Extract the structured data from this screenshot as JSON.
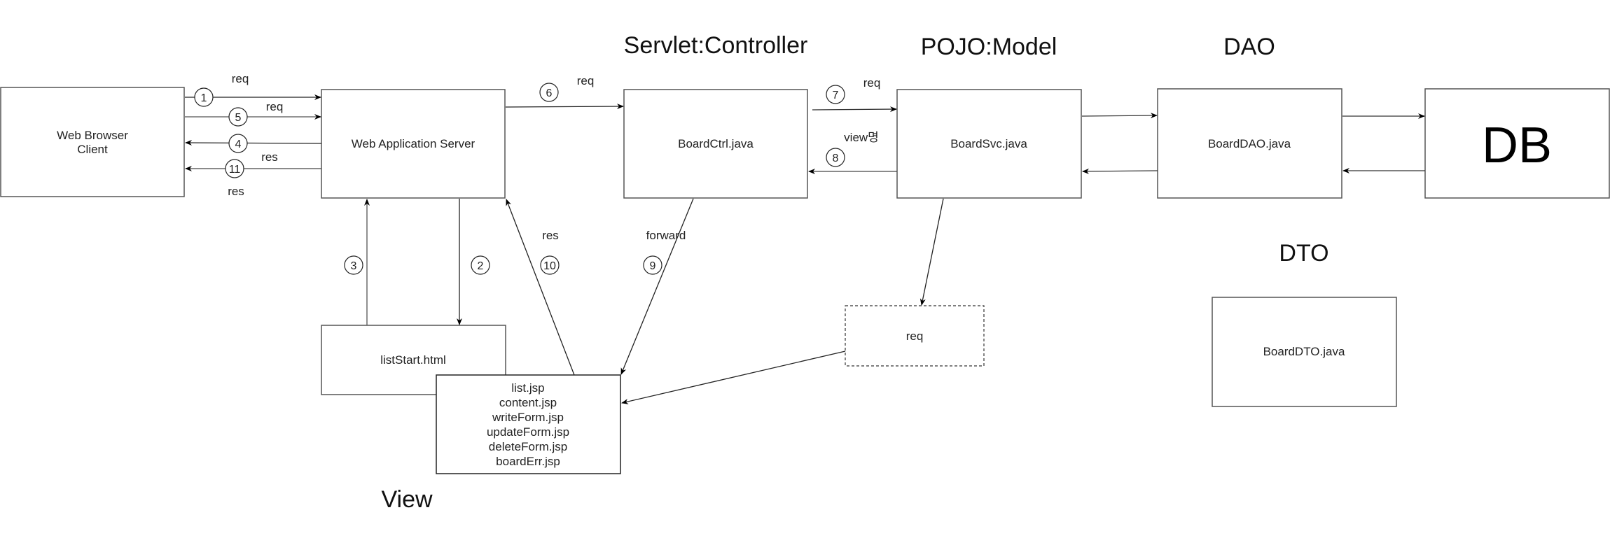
{
  "section_titles": {
    "controller": "Servlet:Controller",
    "model": "POJO:Model",
    "dao": "DAO",
    "dto": "DTO",
    "view": "View"
  },
  "boxes": {
    "client": [
      "Web Browser",
      "Client"
    ],
    "was": "Web Application Server",
    "ctrl": "BoardCtrl.java",
    "svc": "BoardSvc.java",
    "dao": "BoardDAO.java",
    "db": "DB",
    "dto": "BoardDTO.java",
    "req_obj": "req",
    "list_start": "listStart.html",
    "jsp_files": [
      "list.jsp",
      "content.jsp",
      "writeForm.jsp",
      "updateForm.jsp",
      "deleteForm.jsp",
      "boardErr.jsp"
    ]
  },
  "edge_labels": {
    "req1": "req",
    "req5": "req",
    "res4": "res",
    "res11": "res",
    "req6": "req",
    "req7": "req",
    "view8": "view명",
    "res10": "res",
    "forward9": "forward"
  },
  "steps": {
    "s1": "1",
    "s2": "2",
    "s3": "3",
    "s4": "4",
    "s5": "5",
    "s6": "6",
    "s7": "7",
    "s8": "8",
    "s9": "9",
    "s10": "10",
    "s11": "11"
  }
}
